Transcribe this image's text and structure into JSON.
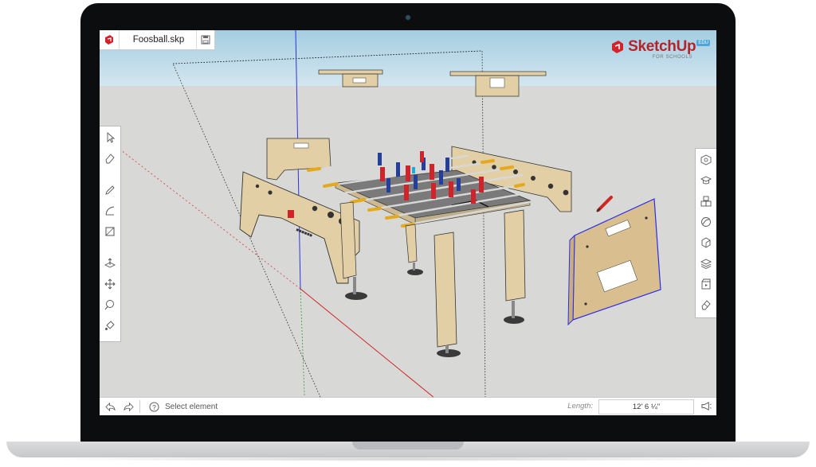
{
  "window": {
    "file_name": "Foosball.skp",
    "app_logo_icon": "sketchup-logo-icon",
    "save_icon": "save-icon"
  },
  "brand": {
    "name": "SketchUp",
    "badge": "EDU",
    "subtitle": "FOR SCHOOLS",
    "color": "#b3242a"
  },
  "left_toolbar": [
    {
      "name": "select-tool",
      "icon": "arrow-icon"
    },
    {
      "name": "eraser-tool",
      "icon": "eraser-icon"
    },
    {
      "name": "pencil-tool",
      "icon": "pencil-icon"
    },
    {
      "name": "arc-tool",
      "icon": "arc-icon"
    },
    {
      "name": "rectangle-tool",
      "icon": "rectangle-icon"
    },
    {
      "name": "push-pull-tool",
      "icon": "push-pull-icon"
    },
    {
      "name": "move-tool",
      "icon": "move-icon"
    },
    {
      "name": "tape-measure-tool",
      "icon": "tape-measure-icon"
    },
    {
      "name": "paint-bucket-tool",
      "icon": "paint-bucket-icon"
    }
  ],
  "right_toolbar": [
    {
      "name": "entity-info-panel",
      "icon": "cube-info-icon"
    },
    {
      "name": "instructor-panel",
      "icon": "mortarboard-icon"
    },
    {
      "name": "components-panel",
      "icon": "components-icon"
    },
    {
      "name": "materials-panel",
      "icon": "materials-icon"
    },
    {
      "name": "styles-panel",
      "icon": "styles-icon"
    },
    {
      "name": "layers-panel",
      "icon": "layers-icon"
    },
    {
      "name": "scenes-panel",
      "icon": "scenes-icon"
    },
    {
      "name": "display-panel",
      "icon": "eraser-display-icon"
    }
  ],
  "status_bar": {
    "status_text": "Select element",
    "length_label": "Length:",
    "length_value": "12' 6 ¼\"",
    "undo_icon": "undo-icon",
    "redo_icon": "redo-icon",
    "help_icon": "help-icon",
    "speaker_icon": "speaker-icon"
  },
  "colors": {
    "sky_top": "#a5cde2",
    "ground": "#d8d8d6",
    "wood": "#e3cfa6",
    "player_red": "#d2232a",
    "player_blue": "#233e9b",
    "handle_yellow": "#e5a91c",
    "selection_blue": "#2a2ee8"
  }
}
